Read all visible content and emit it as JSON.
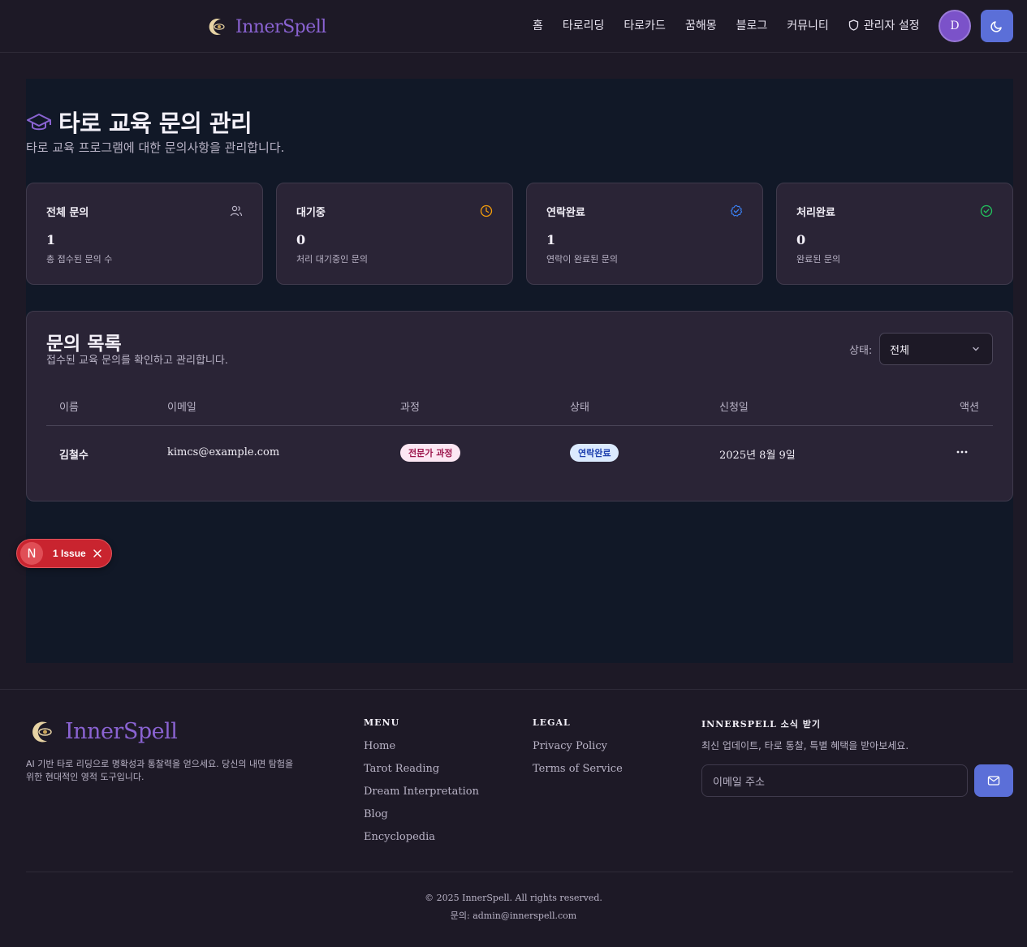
{
  "header": {
    "brand": "InnerSpell",
    "nav": [
      {
        "label": "홈"
      },
      {
        "label": "타로리딩"
      },
      {
        "label": "타로카드"
      },
      {
        "label": "꿈해몽"
      },
      {
        "label": "블로그"
      },
      {
        "label": "커뮤니티"
      }
    ],
    "admin_label": "관리자 설정",
    "avatar_initial": "D"
  },
  "page": {
    "title": "타로 교육 문의 관리",
    "subtitle": "타로 교육 프로그램에 대한 문의사항을 관리합니다."
  },
  "stats": [
    {
      "label": "전체 문의",
      "value": "1",
      "desc": "총 접수된 문의 수",
      "icon": "users-icon"
    },
    {
      "label": "대기중",
      "value": "0",
      "desc": "처리 대기중인 문의",
      "icon": "clock-icon"
    },
    {
      "label": "연락완료",
      "value": "1",
      "desc": "연락이 완료된 문의",
      "icon": "badge-check-icon"
    },
    {
      "label": "처리완료",
      "value": "0",
      "desc": "완료된 문의",
      "icon": "circle-check-icon"
    }
  ],
  "inquiries": {
    "title": "문의 목록",
    "subtitle": "접수된 교육 문의를 확인하고 관리합니다.",
    "filter_label": "상태:",
    "filter_value": "전체",
    "columns": [
      "이름",
      "이메일",
      "과정",
      "상태",
      "신청일",
      "액션"
    ],
    "rows": [
      {
        "name": "김철수",
        "email": "kimcs@example.com",
        "course": "전문가 과정",
        "status": "연락완료",
        "date": "2025년 8월 9일"
      }
    ]
  },
  "issue_badge": {
    "initial": "N",
    "text": "1 Issue"
  },
  "footer": {
    "brand": "InnerSpell",
    "description": "AI 기반 타로 리딩으로 명확성과 통찰력을 얻으세요. 당신의 내면 탐험을 위한 현대적인 영적 도구입니다.",
    "menu_title": "MENU",
    "menu": [
      "Home",
      "Tarot Reading",
      "Dream Interpretation",
      "Blog",
      "Encyclopedia"
    ],
    "legal_title": "LEGAL",
    "legal": [
      "Privacy Policy",
      "Terms of Service"
    ],
    "newsletter_title": "INNERSPELL 소식 받기",
    "newsletter_desc": "최신 업데이트, 타로 통찰, 특별 혜택을 받아보세요.",
    "email_placeholder": "이메일 주소",
    "copyright": "© 2025 InnerSpell. All rights reserved.",
    "contact": "문의: admin@innerspell.com"
  },
  "colors": {
    "brand": "#8a63d2",
    "accent_button": "#5b6fd8",
    "background": "#1d1926",
    "panel": "#111827",
    "card": "#2a2436",
    "clock_icon": "#f59e0b",
    "check_blue": "#3b82f6",
    "check_green": "#22c55e",
    "issue_red": "#c9242f"
  }
}
